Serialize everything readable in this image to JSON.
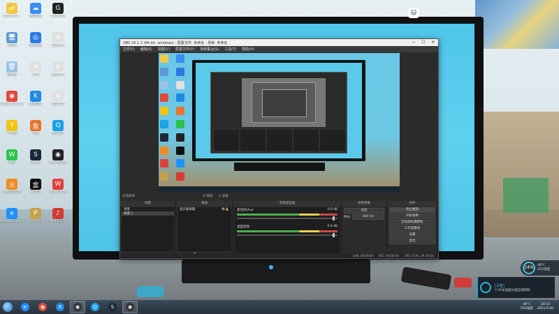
{
  "desktop": {
    "icons": [
      {
        "label": "Administr...",
        "color": "#f0c84a",
        "glyph": "📁"
      },
      {
        "label": "百度网盘",
        "color": "#3b8ef0",
        "glyph": "☁"
      },
      {
        "label": "WeGame",
        "color": "#222",
        "glyph": "G"
      },
      {
        "label": "计算机",
        "color": "#5a9ad6",
        "glyph": "🖥"
      },
      {
        "label": "腾讯会议",
        "color": "#2a7ae2",
        "glyph": "◎"
      },
      {
        "label": "新建文本",
        "color": "#e0e0e0",
        "glyph": "≡"
      },
      {
        "label": "回收站",
        "color": "#9cc3e6",
        "glyph": "🗑"
      },
      {
        "label": "WPS",
        "color": "#e0e0e0",
        "glyph": "≡"
      },
      {
        "label": "新建文本",
        "color": "#e0e0e0",
        "glyph": "≡"
      },
      {
        "label": "Google Chrome",
        "color": "#e04a3a",
        "glyph": "◉"
      },
      {
        "label": "酷狗音乐",
        "color": "#1e88e5",
        "glyph": "K"
      },
      {
        "label": "新建文本",
        "color": "#e0e0e0",
        "glyph": "≡"
      },
      {
        "label": "YY语音",
        "color": "#f1c40f",
        "glyph": "Y"
      },
      {
        "label": "斗鱼",
        "color": "#e8732a",
        "glyph": "鱼"
      },
      {
        "label": "腾讯QQ",
        "color": "#1aa1e8",
        "glyph": "Q"
      },
      {
        "label": "微信",
        "color": "#2dc14e",
        "glyph": "W"
      },
      {
        "label": "Steam",
        "color": "#1b2838",
        "glyph": "S"
      },
      {
        "label": "OBS Studio",
        "color": "#222",
        "glyph": "◉"
      },
      {
        "label": "火绒安全软件",
        "color": "#f08a24",
        "glyph": "火"
      },
      {
        "label": "小黑盒",
        "color": "#111",
        "glyph": "盒"
      },
      {
        "label": "WPS Office",
        "color": "#e0403a",
        "glyph": "W"
      },
      {
        "label": "Internet Explorer",
        "color": "#1e90ff",
        "glyph": "e"
      },
      {
        "label": "PUBG",
        "color": "#c4a24a",
        "glyph": "P"
      },
      {
        "label": "网易云音乐",
        "color": "#d43c33",
        "glyph": "♪"
      }
    ],
    "cat_icon": "cat-icon"
  },
  "obs": {
    "title": "OBS 26.1.1 (64-bit, windows) - 配置文件: 未命名 - 场景: 未命名",
    "menu": [
      "文件(F)",
      "编辑(E)",
      "视图(V)",
      "配置文件(P)",
      "场景集合(S)",
      "工具(T)",
      "帮助(H)"
    ],
    "window_buttons": [
      "—",
      "☐",
      "✕"
    ],
    "no_source": "未选择源",
    "docks": {
      "scenes": {
        "title": "场景",
        "items": [
          "场景",
          "场景 2"
        ],
        "selected": 1
      },
      "sources": {
        "title": "来源",
        "items": [
          "显示器采集"
        ]
      },
      "mixer": {
        "title": "音频混音器",
        "tracks": [
          {
            "name": "麦克风/Aux",
            "db": "0.0 dB"
          },
          {
            "name": "桌面音频",
            "db": "0.0 dB"
          }
        ]
      },
      "transitions": {
        "title": "场景转换",
        "type": "淡出",
        "duration_label": "时长",
        "duration": "300 ms"
      },
      "controls": {
        "title": "控件",
        "buttons": [
          "停止推流",
          "开始录制",
          "启动虚拟摄像机",
          "工作室模式",
          "设置",
          "退出"
        ]
      }
    },
    "status": {
      "live": "LIVE: 00:00:00",
      "rec": "REC: 00:00:00",
      "cpu": "CPU: 0.3%, 29.78 fps"
    }
  },
  "overlays": {
    "cpu_percent": "24%",
    "cpu_temp": "48°C",
    "cpu_label": "CPU温度",
    "notify_title": "[公告]",
    "notify_body": "7.29号凌晨分值区域限制"
  },
  "taskbar": {
    "apps": [
      {
        "name": "ie",
        "color": "#1e90ff",
        "glyph": "e",
        "active": false
      },
      {
        "name": "chrome",
        "color": "#e04a3a",
        "glyph": "◉",
        "active": false
      },
      {
        "name": "kugou",
        "color": "#1e88e5",
        "glyph": "K",
        "active": false
      },
      {
        "name": "obs",
        "color": "#333",
        "glyph": "◉",
        "active": true
      },
      {
        "name": "qq",
        "color": "#1aa1e8",
        "glyph": "Q",
        "active": false
      },
      {
        "name": "steam",
        "color": "#1b2838",
        "glyph": "S",
        "active": false
      },
      {
        "name": "obs2",
        "color": "#333",
        "glyph": "◉",
        "active": true
      }
    ],
    "tray_temp": "48°C",
    "tray_temp_label": "CPU温度",
    "time": "20:53",
    "date": "2021/7/30"
  }
}
